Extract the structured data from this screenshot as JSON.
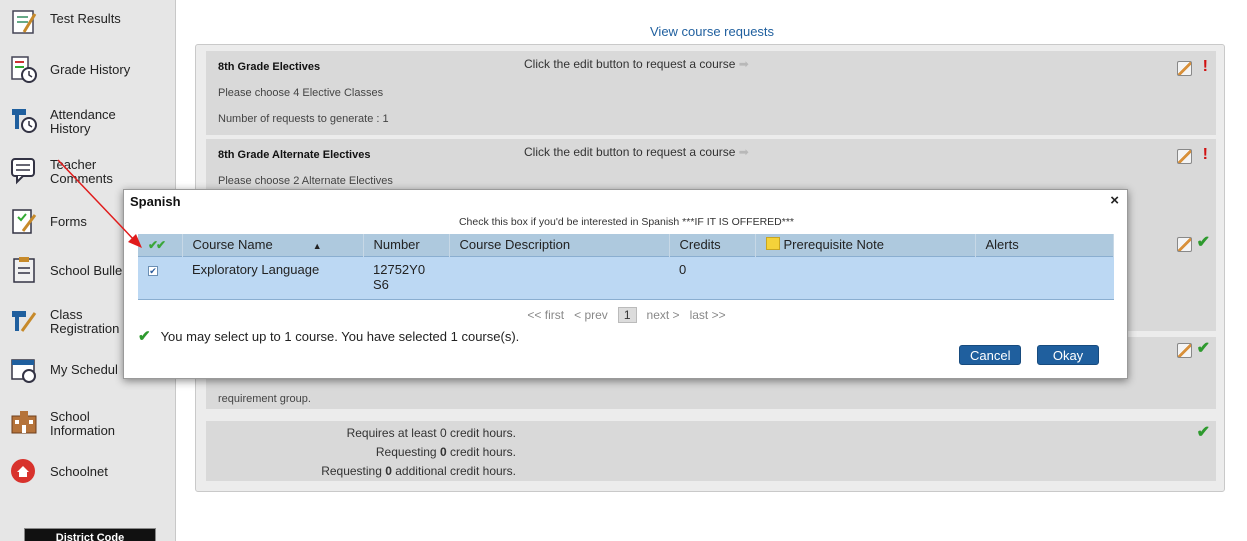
{
  "sidebar": {
    "items": [
      {
        "label": "Test Results",
        "icon": "test-results-icon"
      },
      {
        "label": "Grade History",
        "icon": "grade-history-icon"
      },
      {
        "label": "Attendance\nHistory",
        "icon": "attendance-history-icon"
      },
      {
        "label": "Teacher\nComments",
        "icon": "teacher-comments-icon"
      },
      {
        "label": "Forms",
        "icon": "forms-icon"
      },
      {
        "label": "School Bulle",
        "icon": "school-bulletin-icon"
      },
      {
        "label": "Class\nRegistration",
        "icon": "class-registration-icon"
      },
      {
        "label": "My Schedul",
        "icon": "my-schedule-icon"
      },
      {
        "label": "School\nInformation",
        "icon": "school-information-icon"
      },
      {
        "label": "Schoolnet",
        "icon": "schoolnet-icon"
      }
    ],
    "district_code": "District Code"
  },
  "main": {
    "view_requests_link": "View course requests",
    "groups": [
      {
        "title": "8th Grade Electives",
        "hint": "Click the edit button to request a course",
        "lines": [
          "Please choose 4 Elective Classes",
          "Number of requests to generate : 1"
        ],
        "status": "!"
      },
      {
        "title": "8th Grade Alternate Electives",
        "hint": "Click the edit button to request a course",
        "lines": [
          "Please choose 2 Alternate Electives"
        ],
        "status": "!"
      }
    ],
    "partial_text": "requirement group.",
    "credits": {
      "line1": "Requires at least 0 credit hours.",
      "line2_pre": "Requesting ",
      "line2_num": "0",
      "line2_post": " credit hours.",
      "line3_pre": "Requesting ",
      "line3_num": "0",
      "line3_post": " additional credit hours."
    },
    "ok_mark": "✔"
  },
  "dialog": {
    "title": "Spanish",
    "close": "×",
    "instruction": "Check this box if you'd be interested in Spanish ***IF IT IS OFFERED***",
    "columns": {
      "check": "✔✔",
      "course_name": "Course Name",
      "sort_indicator": "▲",
      "number": "Number",
      "description": "Course Description",
      "credits": "Credits",
      "prerequisite": "Prerequisite Note",
      "alerts": "Alerts"
    },
    "rows": [
      {
        "checked": "✔",
        "course_name": "Exploratory Language",
        "number": "12752Y0\nS6",
        "description": "",
        "credits": "0",
        "prerequisite": "",
        "alerts": ""
      }
    ],
    "pager": {
      "first": "<< first",
      "prev": "< prev",
      "current": "1",
      "next": "next >",
      "last": "last >>"
    },
    "selection_message": "You may select up to 1 course.  You have selected 1 course(s).",
    "ok_icon": "✔",
    "cancel_label": "Cancel",
    "okay_label": "Okay"
  },
  "colors": {
    "accent": "#1f5f9e",
    "header": "#aec9de",
    "selected_row": "#bcd8f3",
    "ok": "#2e9a2e",
    "warn": "#d01010"
  }
}
